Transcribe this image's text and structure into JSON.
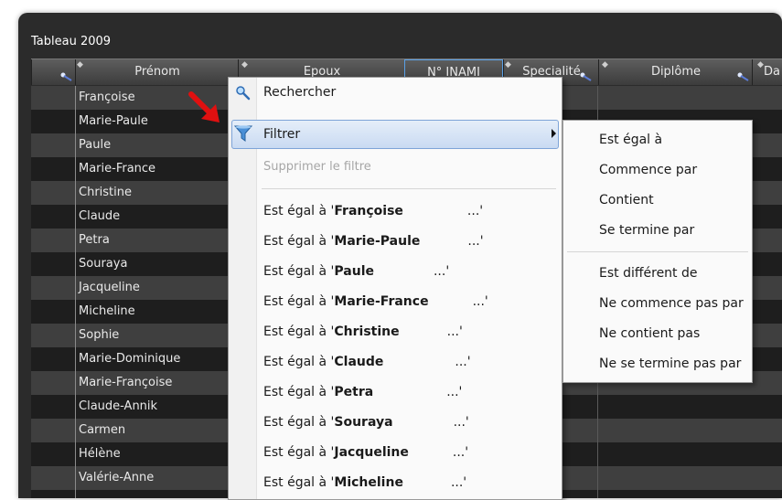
{
  "table": {
    "caption": "Tableau 2009",
    "columns": [
      "Prénom",
      "Epoux",
      "N° INAMI",
      "Specialité",
      "Diplôme",
      "Da"
    ],
    "rows": [
      "Françoise",
      "Marie-Paule",
      "Paule",
      "Marie-France",
      "Christine",
      "Claude",
      "Petra",
      "Souraya",
      "Jacqueline",
      "Micheline",
      "Sophie",
      "Marie-Dominique",
      "Marie-Françoise",
      "Claude-Annik",
      "Carmen",
      "Hélène",
      "Valérie-Anne"
    ]
  },
  "menu": {
    "search": "Rechercher",
    "filter": "Filtrer",
    "remove_filter": "Supprimer le filtre",
    "equals_prefix": "Est égal à '",
    "equals_suffix": "...'",
    "equals_values": [
      "Françoise",
      "Marie-Paule",
      "Paule",
      "Marie-France",
      "Christine",
      "Claude",
      "Petra",
      "Souraya",
      "Jacqueline",
      "Micheline"
    ]
  },
  "submenu": {
    "items": [
      "Est égal à",
      "Commence par",
      "Contient",
      "Se termine par",
      "Est différent de",
      "Ne commence pas par",
      "Ne contient pas",
      "Ne se termine pas par"
    ]
  },
  "colors": {
    "highlight": "#c9daf2",
    "arrow": "#e01010",
    "funnel": "#4a8fd6"
  },
  "icons": [
    "magnifier-icon",
    "funnel-icon",
    "red-arrow-icon",
    "submenu-arrow-icon"
  ]
}
